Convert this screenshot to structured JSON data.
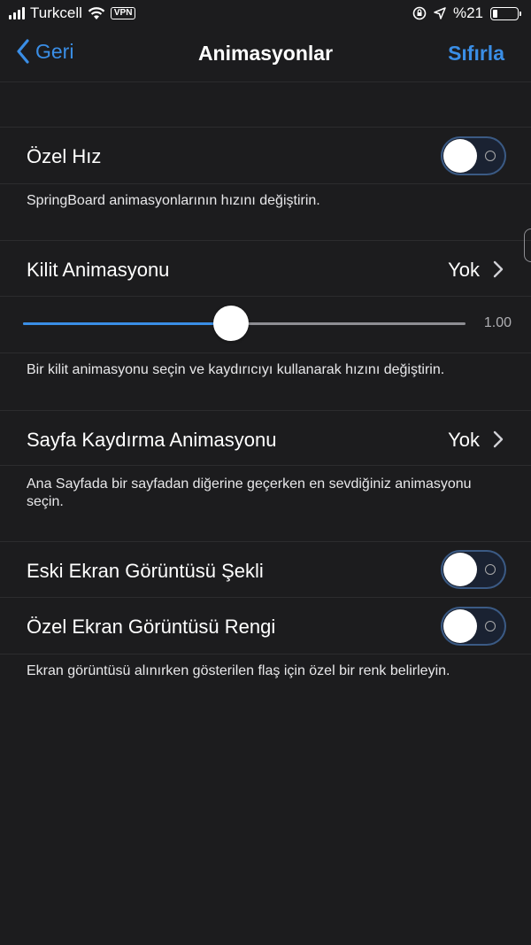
{
  "status_bar": {
    "carrier": "Turkcell",
    "vpn": "VPN",
    "battery": "%21",
    "battery_level": 0.21
  },
  "nav": {
    "back_label": "Geri",
    "title": "Animasyonlar",
    "reset_label": "Sıfırla"
  },
  "custom_speed": {
    "label": "Özel Hız",
    "enabled": false,
    "footer": "SpringBoard animasyonlarının hızını değiştirin."
  },
  "lock_animation": {
    "label": "Kilit Animasyonu",
    "value": "Yok",
    "slider_value": "1.00",
    "slider_fraction": 0.47,
    "footer": "Bir kilit animasyonu seçin ve kaydırıcıyı kullanarak hızını değiştirin."
  },
  "page_scroll_animation": {
    "label": "Sayfa Kaydırma Animasyonu",
    "value": "Yok",
    "footer": "Ana Sayfada bir sayfadan diğerine geçerken en sevdiğiniz animasyonu seçin."
  },
  "screenshot": {
    "legacy_label": "Eski Ekran Görüntüsü Şekli",
    "legacy_enabled": false,
    "custom_color_label": "Özel Ekran Görüntüsü Rengi",
    "custom_color_enabled": false,
    "footer": "Ekran görüntüsü alınırken gösterilen flaş için özel bir renk belirleyin."
  },
  "colors": {
    "accent": "#3a8ee6",
    "background": "#1c1c1e",
    "separator": "#2c2c2e"
  },
  "icons": [
    "signal-icon",
    "wifi-icon",
    "rotation-lock-icon",
    "location-arrow-icon",
    "battery-icon",
    "chevron-left-icon",
    "chevron-right-icon"
  ]
}
